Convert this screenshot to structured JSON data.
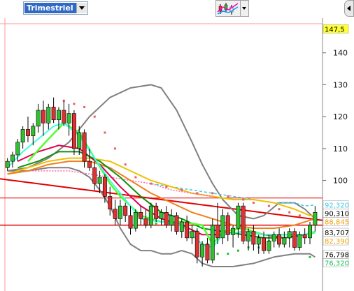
{
  "toolbar": {
    "period_select": {
      "value": "Trimestriel"
    },
    "indicator_icon": "candlestick-indicators-icon",
    "dropdown_icon": "chevron-down-icon",
    "scroll_icon": "chevron-left-icon"
  },
  "chart_data": {
    "type": "candlestick",
    "title": "",
    "xlabel": "",
    "ylabel": "",
    "ylim": [
      66,
      150
    ],
    "grid": false,
    "y_ticks": [
      140,
      130,
      120,
      110,
      100
    ],
    "price_labels": [
      {
        "text": "147,5",
        "value": 147.5,
        "bg": "#ffff33",
        "fg": "#000000"
      },
      {
        "text": "92,320",
        "value": 92.32,
        "bg": "#ffffff",
        "fg": "#40c8e8"
      },
      {
        "text": "90,310",
        "value": 90.31,
        "bg": "#ffffff",
        "fg": "#000000"
      },
      {
        "text": "88,845",
        "value": 88.845,
        "bg": "#ffffff",
        "fg": "#f0a000"
      },
      {
        "text": "83,707",
        "value": 83.707,
        "bg": "#ffffff",
        "fg": "#000000"
      },
      {
        "text": "82,390",
        "value": 82.39,
        "bg": "#ffffff",
        "fg": "#f0a000"
      },
      {
        "text": "76,798",
        "value": 76.798,
        "bg": "#ffffff",
        "fg": "#000000"
      },
      {
        "text": "76,320",
        "value": 76.32,
        "bg": "#ffffff",
        "fg": "#20c060"
      }
    ],
    "candles": [
      [
        104,
        107,
        103,
        106
      ],
      [
        106,
        109,
        104,
        108
      ],
      [
        108,
        113,
        106,
        112
      ],
      [
        112,
        117,
        110,
        116
      ],
      [
        116,
        120,
        112,
        114
      ],
      [
        114,
        118,
        111,
        117
      ],
      [
        117,
        124,
        115,
        122
      ],
      [
        122,
        125,
        114,
        118
      ],
      [
        118,
        124,
        116,
        123
      ],
      [
        123,
        126,
        118,
        119
      ],
      [
        119,
        123,
        116,
        122
      ],
      [
        122,
        125,
        117,
        118
      ],
      [
        118,
        124,
        114,
        121
      ],
      [
        121,
        122,
        108,
        110
      ],
      [
        110,
        117,
        108,
        115
      ],
      [
        115,
        116,
        104,
        106
      ],
      [
        106,
        110,
        103,
        104
      ],
      [
        104,
        106,
        97,
        99
      ],
      [
        99,
        103,
        96,
        101
      ],
      [
        101,
        102,
        93,
        95
      ],
      [
        95,
        98,
        89,
        91
      ],
      [
        91,
        94,
        86,
        88
      ],
      [
        88,
        94,
        86,
        92
      ],
      [
        92,
        93,
        87,
        89
      ],
      [
        89,
        92,
        83,
        85
      ],
      [
        85,
        91,
        84,
        90
      ],
      [
        90,
        92,
        86,
        88
      ],
      [
        88,
        91,
        85,
        86
      ],
      [
        86,
        93,
        85,
        92
      ],
      [
        92,
        93,
        87,
        88
      ],
      [
        88,
        91,
        86,
        90
      ],
      [
        90,
        92,
        85,
        86
      ],
      [
        86,
        91,
        84,
        89
      ],
      [
        89,
        90,
        83,
        84
      ],
      [
        84,
        88,
        82,
        87
      ],
      [
        87,
        89,
        81,
        82
      ],
      [
        82,
        86,
        80,
        84
      ],
      [
        84,
        85,
        74,
        76
      ],
      [
        76,
        81,
        73,
        80
      ],
      [
        80,
        82,
        74,
        75
      ],
      [
        75,
        88,
        74,
        86
      ],
      [
        86,
        93,
        80,
        82
      ],
      [
        82,
        91,
        80,
        89
      ],
      [
        89,
        90,
        81,
        83
      ],
      [
        83,
        86,
        79,
        85
      ],
      [
        85,
        93,
        82,
        92
      ],
      [
        92,
        93,
        80,
        81
      ],
      [
        81,
        85,
        78,
        84
      ],
      [
        84,
        86,
        78,
        80
      ],
      [
        80,
        83,
        77,
        82
      ],
      [
        82,
        84,
        77,
        78
      ],
      [
        78,
        83,
        77,
        81
      ],
      [
        81,
        84,
        79,
        83
      ],
      [
        83,
        85,
        79,
        80
      ],
      [
        80,
        84,
        79,
        82
      ],
      [
        82,
        85,
        79,
        84
      ],
      [
        84,
        85,
        78,
        79
      ],
      [
        79,
        84,
        78,
        83
      ],
      [
        83,
        85,
        80,
        82
      ],
      [
        82,
        87,
        80,
        86
      ],
      [
        86,
        92,
        84,
        90
      ]
    ],
    "overlays": [
      {
        "color": "#808080",
        "width": 2,
        "dash": "",
        "points": [
          [
            0,
            103
          ],
          [
            4,
            104
          ],
          [
            8,
            107
          ],
          [
            12,
            112
          ],
          [
            16,
            120
          ],
          [
            20,
            126
          ],
          [
            24,
            129
          ],
          [
            28,
            130
          ],
          [
            30,
            129
          ],
          [
            33,
            122
          ],
          [
            36,
            112
          ],
          [
            38,
            105
          ],
          [
            40,
            99
          ],
          [
            42,
            94
          ],
          [
            45,
            89
          ],
          [
            48,
            88
          ],
          [
            50,
            89
          ],
          [
            53,
            93
          ],
          [
            56,
            93
          ],
          [
            58,
            91
          ],
          [
            60,
            88
          ]
        ]
      },
      {
        "color": "#808080",
        "width": 2,
        "dash": "",
        "points": [
          [
            0,
            103
          ],
          [
            4,
            103
          ],
          [
            8,
            104
          ],
          [
            12,
            104
          ],
          [
            14,
            103
          ],
          [
            16,
            101
          ],
          [
            18,
            97
          ],
          [
            20,
            92
          ],
          [
            22,
            85
          ],
          [
            24,
            80
          ],
          [
            26,
            78
          ],
          [
            28,
            78
          ],
          [
            30,
            77
          ],
          [
            32,
            77
          ],
          [
            34,
            78
          ],
          [
            36,
            77
          ],
          [
            38,
            74
          ],
          [
            40,
            73
          ],
          [
            44,
            73
          ],
          [
            48,
            74
          ],
          [
            52,
            76
          ],
          [
            56,
            77
          ],
          [
            59,
            77
          ],
          [
            60,
            76
          ]
        ]
      },
      {
        "color": "#40c8e8",
        "width": 1.5,
        "dash": "4,3",
        "points": [
          [
            28,
            99
          ],
          [
            32,
            98
          ],
          [
            36,
            97
          ],
          [
            40,
            96
          ],
          [
            44,
            95
          ],
          [
            48,
            94
          ],
          [
            52,
            93
          ],
          [
            56,
            93
          ],
          [
            58,
            92
          ],
          [
            60,
            92.3
          ]
        ]
      },
      {
        "color": "#f0c000",
        "width": 2,
        "dash": "",
        "points": [
          [
            0,
            102
          ],
          [
            4,
            104
          ],
          [
            8,
            106
          ],
          [
            12,
            107
          ],
          [
            16,
            107
          ],
          [
            20,
            106
          ],
          [
            24,
            103
          ],
          [
            28,
            100
          ],
          [
            32,
            98
          ],
          [
            36,
            96
          ],
          [
            40,
            95
          ],
          [
            44,
            94
          ],
          [
            48,
            94
          ],
          [
            52,
            93
          ],
          [
            56,
            91
          ],
          [
            59,
            89
          ],
          [
            60,
            88.8
          ]
        ]
      },
      {
        "color": "#ff66aa",
        "width": 1.5,
        "dash": "2,2",
        "points": [
          [
            0,
            102
          ],
          [
            4,
            103
          ],
          [
            8,
            103
          ],
          [
            12,
            103
          ],
          [
            16,
            102
          ],
          [
            20,
            101
          ],
          [
            24,
            100
          ],
          [
            28,
            99
          ],
          [
            32,
            97
          ],
          [
            36,
            96
          ],
          [
            40,
            95
          ]
        ]
      },
      {
        "color": "#f08020",
        "width": 2,
        "dash": "",
        "points": [
          [
            0,
            102
          ],
          [
            4,
            103
          ],
          [
            8,
            105
          ],
          [
            12,
            106
          ],
          [
            16,
            106
          ],
          [
            20,
            104
          ],
          [
            24,
            100
          ],
          [
            28,
            96
          ],
          [
            32,
            93
          ],
          [
            36,
            90
          ],
          [
            40,
            88
          ],
          [
            44,
            86
          ],
          [
            48,
            85
          ],
          [
            52,
            85
          ],
          [
            56,
            86
          ],
          [
            60,
            88
          ]
        ]
      },
      {
        "color": "#e00050",
        "width": 2,
        "dash": "",
        "points": [
          [
            2,
            106
          ],
          [
            6,
            109
          ],
          [
            10,
            111
          ],
          [
            14,
            110
          ],
          [
            18,
            105
          ],
          [
            22,
            98
          ],
          [
            26,
            92
          ],
          [
            30,
            88
          ],
          [
            34,
            86
          ],
          [
            38,
            83
          ],
          [
            42,
            83
          ],
          [
            46,
            84
          ],
          [
            50,
            83
          ],
          [
            54,
            82
          ],
          [
            58,
            83
          ],
          [
            60,
            84
          ]
        ]
      },
      {
        "color": "#109010",
        "width": 2,
        "dash": "",
        "points": [
          [
            2,
            104
          ],
          [
            6,
            106
          ],
          [
            10,
            109
          ],
          [
            14,
            109
          ],
          [
            18,
            106
          ],
          [
            22,
            101
          ],
          [
            26,
            95
          ],
          [
            30,
            90
          ],
          [
            34,
            88
          ],
          [
            38,
            85
          ],
          [
            42,
            84
          ],
          [
            46,
            83
          ],
          [
            50,
            82
          ],
          [
            54,
            82
          ],
          [
            58,
            83
          ],
          [
            60,
            83.7
          ]
        ]
      },
      {
        "color": "#50ff30",
        "width": 2.5,
        "dash": "",
        "points": [
          [
            4,
            106
          ],
          [
            8,
            113
          ],
          [
            11,
            118
          ],
          [
            14,
            115
          ],
          [
            17,
            107
          ],
          [
            20,
            99
          ],
          [
            22,
            95
          ],
          [
            26,
            89
          ],
          [
            30,
            87
          ],
          [
            34,
            87
          ],
          [
            38,
            86
          ],
          [
            40,
            80
          ],
          [
            42,
            84
          ],
          [
            46,
            85
          ],
          [
            50,
            83
          ],
          [
            54,
            83
          ],
          [
            58,
            83
          ],
          [
            60,
            83.7
          ]
        ]
      },
      {
        "color": "#40ffe0",
        "width": 2,
        "dash": "",
        "points": [
          [
            0,
            104
          ],
          [
            3,
            109
          ],
          [
            6,
            113
          ],
          [
            9,
            117
          ],
          [
            11,
            118
          ],
          [
            14,
            114
          ],
          [
            17,
            107
          ],
          [
            20,
            100
          ],
          [
            23,
            94
          ],
          [
            26,
            88
          ],
          [
            30,
            87
          ],
          [
            34,
            86
          ],
          [
            38,
            80
          ],
          [
            40,
            79
          ],
          [
            42,
            83
          ],
          [
            46,
            84
          ],
          [
            50,
            83
          ],
          [
            54,
            83
          ],
          [
            58,
            83
          ],
          [
            60,
            84
          ]
        ]
      }
    ],
    "sar_dots": [
      {
        "color": "#e86060",
        "points": [
          [
            11,
            125
          ],
          [
            13,
            124
          ],
          [
            15,
            123
          ],
          [
            17,
            120
          ],
          [
            19,
            115
          ],
          [
            21,
            110
          ],
          [
            23,
            105
          ],
          [
            25,
            101
          ],
          [
            28,
            99
          ],
          [
            31,
            98
          ],
          [
            34,
            97
          ],
          [
            37,
            96
          ],
          [
            40,
            96
          ],
          [
            43,
            95
          ],
          [
            46,
            94
          ],
          [
            48,
            93
          ],
          [
            51,
            92
          ],
          [
            53,
            91
          ],
          [
            55,
            90
          ],
          [
            57,
            89
          ]
        ]
      },
      {
        "color": "#20c030",
        "points": [
          [
            27,
            86
          ],
          [
            29,
            86.5
          ],
          [
            31,
            86.6
          ],
          [
            33,
            87
          ],
          [
            35,
            87.2
          ],
          [
            37,
            84
          ],
          [
            39,
            80
          ],
          [
            41,
            77
          ],
          [
            43,
            77
          ],
          [
            45,
            78
          ],
          [
            47,
            79
          ],
          [
            49,
            79
          ],
          [
            51,
            81
          ],
          [
            53,
            82
          ],
          [
            55,
            82
          ],
          [
            59,
            76
          ]
        ]
      }
    ],
    "trend_lines": [
      {
        "color": "#e00000",
        "width": 2,
        "points": [
          [
            0,
            100.5
          ],
          [
            60,
            87.5
          ]
        ]
      },
      {
        "color": "#e00000",
        "width": 1.5,
        "points": [
          [
            0,
            86
          ],
          [
            60,
            86
          ]
        ]
      },
      {
        "color": "#e00000",
        "width": 1,
        "points": [
          [
            0,
            94.5
          ],
          [
            60,
            94.5
          ]
        ]
      }
    ]
  }
}
